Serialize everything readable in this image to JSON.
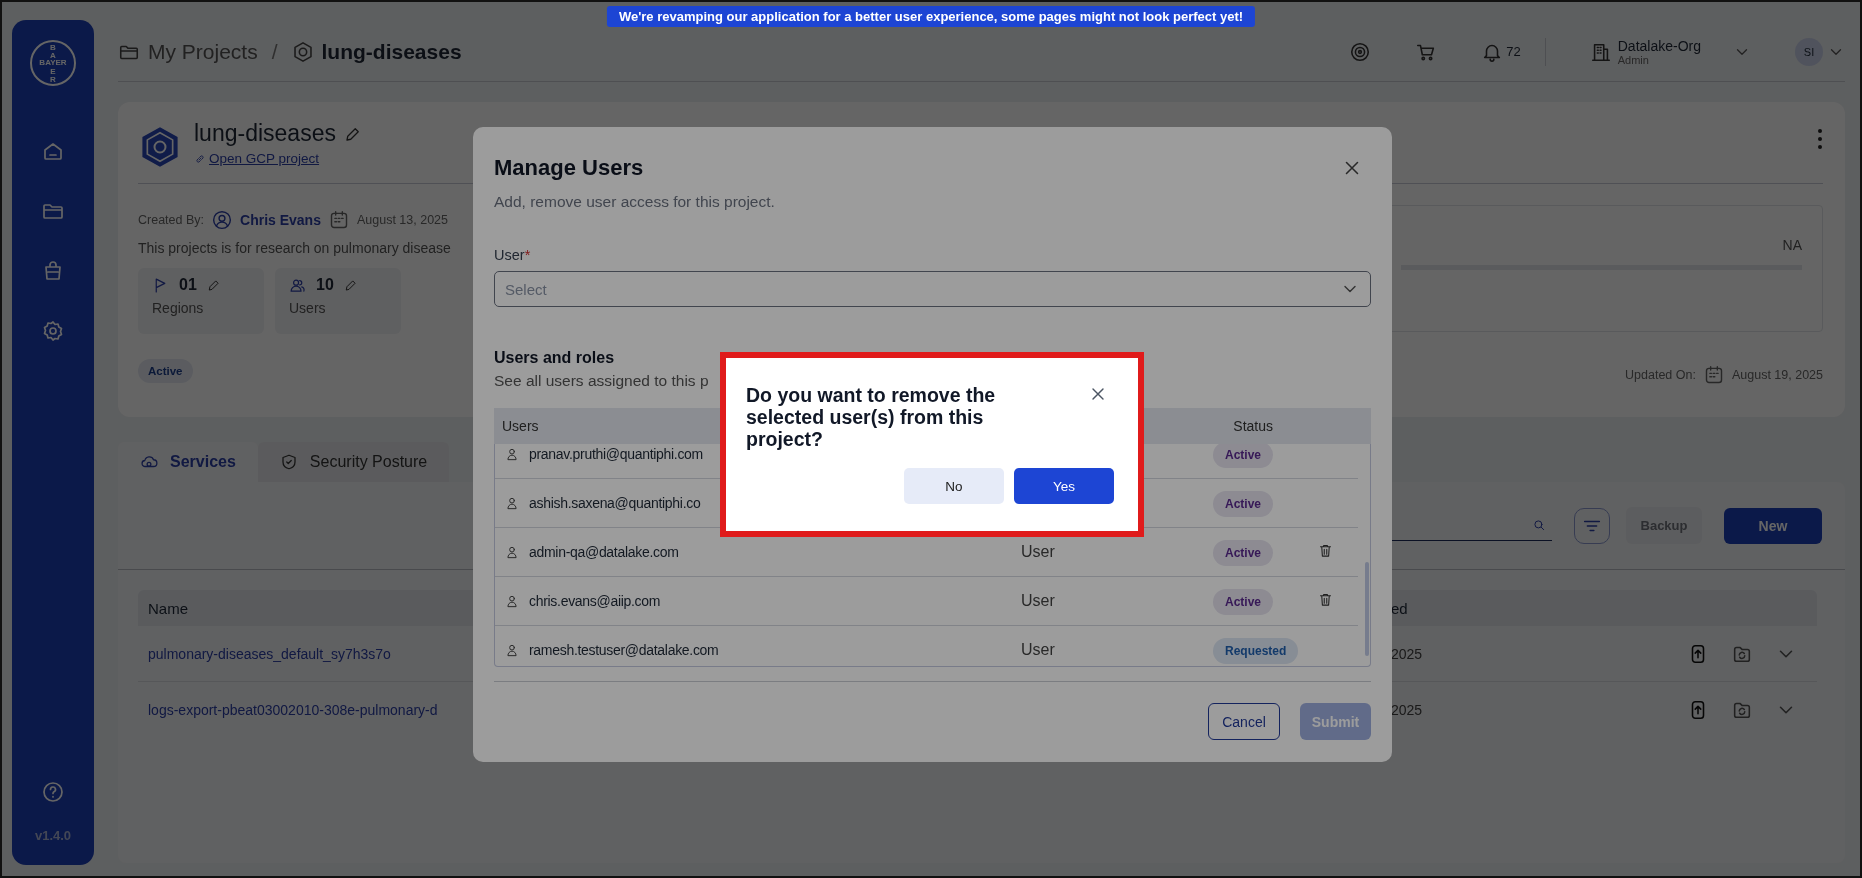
{
  "banner": {
    "text": "We're revamping our application for a better user experience, some pages might not look perfect yet!"
  },
  "sidebar": {
    "logo": {
      "horizontal": "BAYER",
      "vertical_top": "BA",
      "vertical_bottom": "ER"
    },
    "version": "v1.4.0"
  },
  "header": {
    "breadcrumb": [
      {
        "label": "My Projects",
        "current": false
      },
      {
        "label": "lung-diseases",
        "current": true
      }
    ],
    "separator": "/",
    "notification_count": "72",
    "org": {
      "name": "Datalake-Org",
      "role": "Admin"
    },
    "avatar": "SI"
  },
  "project": {
    "title": "lung-diseases",
    "link": "Open GCP project",
    "created_by_label": "Created By:",
    "creator": "Chris Evans",
    "created_date": "August 13, 2025",
    "description": "This projects is for research on pulmonary disease",
    "stats": [
      {
        "value": "01",
        "label": "Regions"
      },
      {
        "value": "10",
        "label": "Users"
      }
    ],
    "status": "Active",
    "summary_value": "NA",
    "updated_label": "Updated On:",
    "updated_date": "August 19, 2025"
  },
  "tabs": [
    {
      "label": "Services",
      "selected": true
    },
    {
      "label": "Security Posture",
      "selected": false
    }
  ],
  "services": {
    "backup": {
      "label": "Backup",
      "disabled": true
    },
    "new_label": "New",
    "columns": [
      "Name",
      "ed"
    ],
    "rows": [
      {
        "name": "pulmonary-diseases_default_sy7h3s7o",
        "column_2": "2025"
      },
      {
        "name": "logs-export-pbeat03002010-308e-pulmonary-d",
        "column_2": "2025"
      }
    ]
  },
  "manage_users": {
    "title": "Manage Users",
    "subtitle": "Add, remove user access for this project.",
    "user_label": "User",
    "required_mark": "*",
    "placeholder": "Select",
    "section_title": "Users and roles",
    "section_subtitle": "See all users assigned to this p",
    "columns": [
      "Users",
      "Status"
    ],
    "rows": [
      {
        "user": "pranav.pruthi@quantiphi.com",
        "status": {
          "label": "Active",
          "kind": "active"
        },
        "removable": false
      },
      {
        "user": "ashish.saxena@quantiphi.co",
        "status": {
          "label": "Active",
          "kind": "active"
        },
        "removable": false
      },
      {
        "user": "admin-qa@datalake.com",
        "role": "User",
        "status": {
          "label": "Active",
          "kind": "active"
        },
        "removable": true
      },
      {
        "user": "chris.evans@aiip.com",
        "role": "User",
        "status": {
          "label": "Active",
          "kind": "active"
        },
        "removable": true
      },
      {
        "user": "ramesh.testuser@datalake.com",
        "role": "User",
        "status": {
          "label": "Requested",
          "kind": "requested"
        },
        "removable": false
      }
    ],
    "cancel": "Cancel",
    "submit": {
      "label": "Submit",
      "disabled": true
    }
  },
  "confirm": {
    "message": "Do you want to remove the selected user(s) from this project?",
    "buttons": [
      {
        "label": "No",
        "kind": "secondary"
      },
      {
        "label": "Yes",
        "kind": "primary"
      }
    ]
  }
}
